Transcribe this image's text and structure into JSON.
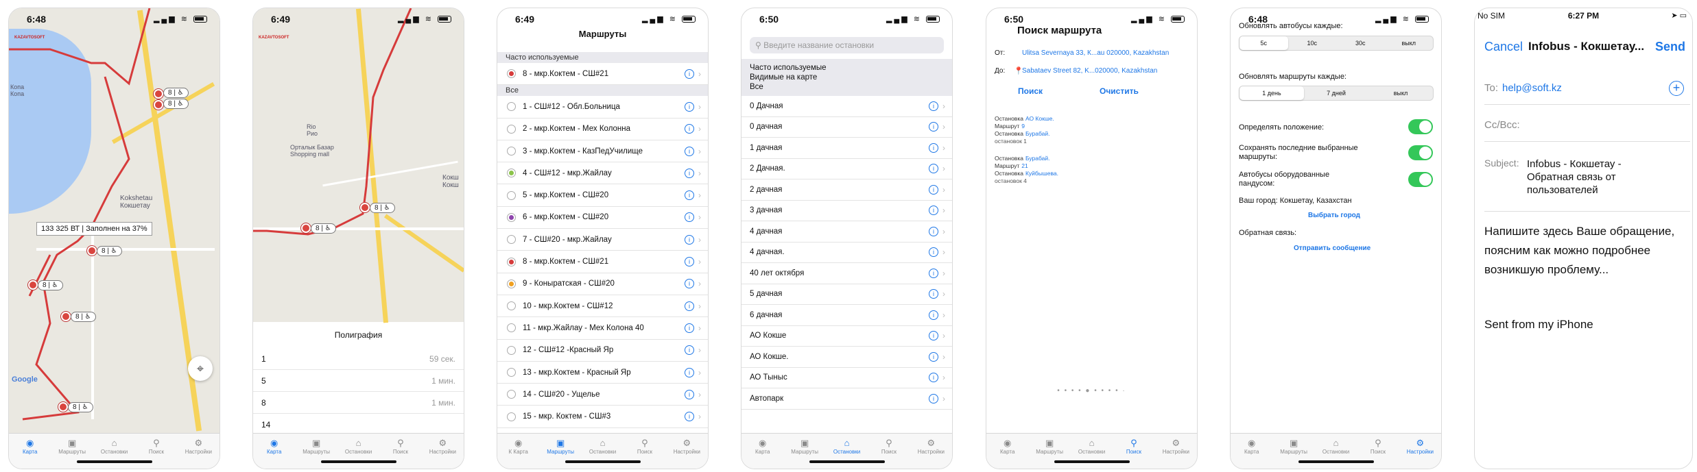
{
  "tabs": [
    "Карта",
    "Маршруты",
    "Остановки",
    "Поиск",
    "Настройки"
  ],
  "tabs_p3": [
    "К Карта",
    "Маршруты",
    "Остановки",
    "Поиск",
    "Настройки"
  ],
  "screen1": {
    "time": "6:48",
    "logo": "KAZAVTOSOFT",
    "tooltip": "133 325 ВТ | Заполнен на 37%",
    "bus_label": "8 | ♿",
    "city_label": "Kokshetau\nКокшетау",
    "lake_label": "Копа\nКопа",
    "google": "Google"
  },
  "screen2": {
    "time": "6:49",
    "logo": "KAZAVTOSOFT",
    "panel_title": "Полиграфия",
    "poi1": "Rio\nРио",
    "poi2": "Орталык Базар\nShopping mall",
    "city_label": "Кокш\nКокш",
    "bus_label": "8 | ♿",
    "arrivals": [
      {
        "route": "1",
        "time": "59 сек."
      },
      {
        "route": "5",
        "time": "1 мин."
      },
      {
        "route": "8",
        "time": "1 мин."
      },
      {
        "route": "14",
        "time": ""
      }
    ]
  },
  "screen3": {
    "time": "6:49",
    "title": "Маршруты",
    "sec_frequent": "Часто используемые",
    "frequent": [
      {
        "label": "8 - мкр.Коктем - СШ#21",
        "color": "#d63b3b"
      }
    ],
    "sec_all": "Все",
    "routes": [
      {
        "label": "1 - СШ#12 - Обл.Больница",
        "color": ""
      },
      {
        "label": "2 - мкр.Коктем - Мех Колонна",
        "color": ""
      },
      {
        "label": "3 - мкр.Коктем - КазПедУчилище",
        "color": ""
      },
      {
        "label": "4 - СШ#12 - мкр.Жайлау",
        "color": "#8bc34a"
      },
      {
        "label": "5 - мкр.Коктем - СШ#20",
        "color": ""
      },
      {
        "label": "6 - мкр.Коктем - СШ#20",
        "color": "#8e44ad"
      },
      {
        "label": "7 - СШ#20 - мкр.Жайлау",
        "color": ""
      },
      {
        "label": "8 - мкр.Коктем - СШ#21",
        "color": "#d63b3b"
      },
      {
        "label": "9 - Коныратская - СШ#20",
        "color": "#f0a020"
      },
      {
        "label": "10 - мкр.Коктем - СШ#12",
        "color": ""
      },
      {
        "label": "11 - мкр.Жайлау - Мех Колона 40",
        "color": ""
      },
      {
        "label": "12 - СШ#12 -Красный Яр",
        "color": ""
      },
      {
        "label": "13 - мкр.Коктем - Красный Яр",
        "color": ""
      },
      {
        "label": "14 - СШ#20 - Ущелье",
        "color": ""
      },
      {
        "label": "15 - мкр. Коктем - СШ#3",
        "color": ""
      }
    ]
  },
  "screen4": {
    "time": "6:50",
    "search_placeholder": "Введите название остановки",
    "filters": [
      "Часто используемые",
      "Видимые на карте",
      "Все"
    ],
    "stops": [
      "0 Дачная",
      "0 дачная",
      "1 дачная",
      "2 Дачная.",
      "2 дачная",
      "3 дачная",
      "4 дачная",
      "4 дачная.",
      "40 лет октября",
      "5 дачная",
      "6 дачная",
      "АО Кокше",
      "АО Кокше.",
      "АО Тыныс",
      "Автопарк"
    ]
  },
  "screen5": {
    "time": "6:50",
    "title": "Поиск маршрута",
    "from_label": "От:",
    "from_value": "Ulitsa Severnaya 33, К...au 020000, Kazakhstan",
    "to_label": "До:",
    "to_value": "Sabataev Street 82, K...020000, Kazakhstan",
    "search_btn": "Поиск",
    "clear_btn": "Очистить",
    "results": [
      {
        "stop_label": "Остановка",
        "stop": "АО Кокше.",
        "route_label": "Маршрут",
        "route": "9",
        "stop2_label": "Остановка",
        "stop2": "Бурабай.",
        "count": "остановок 1"
      },
      {
        "stop_label": "Остановка",
        "stop": "Бурабай.",
        "route_label": "Маршрут",
        "route": "21",
        "stop2_label": "Остановка",
        "stop2": "Куйбышева.",
        "count": "остановок 4"
      }
    ],
    "pager": "• • • • ● • • • • ·"
  },
  "screen6": {
    "time": "6:48",
    "buses_label": "Обновлять автобусы каждые:",
    "buses_opts": [
      "5с",
      "10с",
      "30с",
      "выкл"
    ],
    "routes_label": "Обновлять маршруты каждые:",
    "routes_opts": [
      "1 день",
      "7 дней",
      "выкл"
    ],
    "opt1": "Определять положение:",
    "opt2": "Сохранять последние выбранные маршруты:",
    "opt3": "Автобусы оборудованные пандусом:",
    "city": "Ваш город: Кокшетау, Казахстан",
    "choose_city": "Выбрать город",
    "feedback": "Обратная связь:",
    "send_msg": "Отправить сообщение"
  },
  "screen7": {
    "carrier": "No SIM",
    "time": "6:27 PM",
    "cancel": "Cancel",
    "title": "Infobus - Кокшетау...",
    "send": "Send",
    "to_label": "To:",
    "to_value": "help@soft.kz",
    "cc_label": "Cc/Bcc:",
    "subject_label": "Subject:",
    "subject_value": "Infobus - Кокшетау - Обратная связь от пользователей",
    "body": "Напишите здесь Ваше обращение, поясним как можно подробнее возникшую проблему...",
    "signature": "Sent from my iPhone"
  },
  "colors": {
    "accent": "#1e77e6",
    "route": "#d63b3b",
    "toggle": "#34c759"
  }
}
